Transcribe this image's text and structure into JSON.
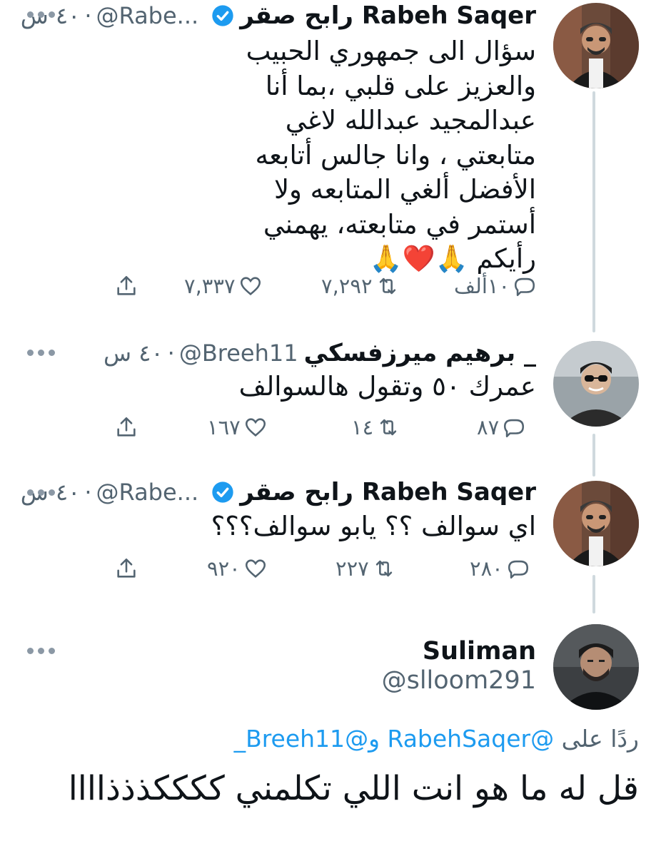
{
  "tweets": [
    {
      "name": "رابح صقر Rabeh Saqer",
      "verified": true,
      "handle": "@Rabe...",
      "time": "٤٠ س",
      "text_lines": [
        "سؤال الى جمهوري الحبيب",
        "والعزيز على قلبي ،بما أنا",
        "عبدالمجيد عبدالله لاغي",
        "متابعتي ، وانا جالس أتابعه",
        "الأفضل ألغي المتابعه ولا",
        "أستمر في متابعته، يهمني",
        "رأيكم 🙏❤️🙏"
      ],
      "replies": "١٠ألف",
      "retweets": "٧,٢٩٢",
      "likes": "٧,٣٣٧"
    },
    {
      "name": "برهيم ميرزفسكي _",
      "verified": false,
      "handle": "@Breeh11",
      "time": "٤٠ س",
      "text_lines": [
        "عمرك ٥٠ وتقول هالسوالف"
      ],
      "replies": "٨٧",
      "retweets": "١٤",
      "likes": "١٦٧"
    },
    {
      "name": "رابح صقر Rabeh Saqer",
      "verified": true,
      "handle": "@Rabe...",
      "time": "٤٠ س",
      "text_lines": [
        "اي سوالف ؟؟ يابو سوالف؟؟؟"
      ],
      "replies": "٢٨٠",
      "retweets": "٢٢٧",
      "likes": "٩٢٠"
    }
  ],
  "main_tweet": {
    "name": "Suliman",
    "handle": "@slloom291",
    "reply_prefix": "ردًا على",
    "reply_mention_1": "@RabehSaqer",
    "reply_and": "و",
    "reply_mention_2": "@Breeh11_",
    "text": "قل له ما هو انت اللي تكلمني ككككذذذاااا"
  },
  "icons": {
    "reply": "reply-icon",
    "retweet": "retweet-icon",
    "like": "heart-icon",
    "share": "share-icon",
    "more": "more-icon",
    "verified": "verified-badge-icon"
  },
  "colors": {
    "accent": "#1d9bf0",
    "secondary_text": "#536471",
    "thread_line": "#cfd9de"
  }
}
